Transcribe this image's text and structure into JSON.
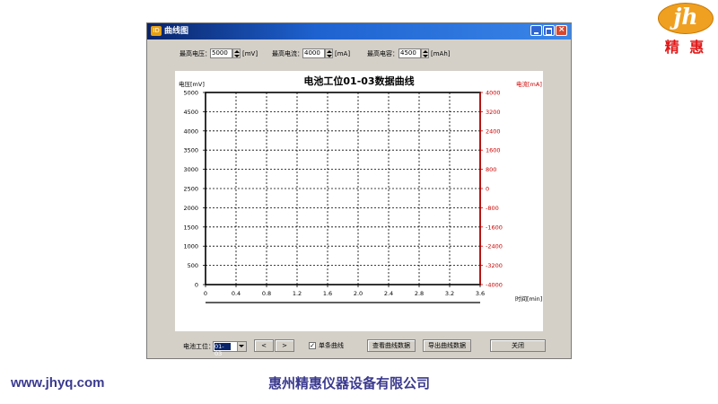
{
  "logo": {
    "mark": "jh",
    "text": "精 惠"
  },
  "footer": {
    "url": "www.jhyq.com",
    "company": "惠州精惠仪器设备有限公司"
  },
  "window": {
    "title": "曲线图",
    "app_icon": "app-icon"
  },
  "params": {
    "max_voltage_label": "最高电压：",
    "max_voltage_value": "5000",
    "max_voltage_unit": "[mV]",
    "max_current_label": "最高电流：",
    "max_current_value": "4000",
    "max_current_unit": "[mA]",
    "max_capacity_label": "最高电容：",
    "max_capacity_value": "4500",
    "max_capacity_unit": "[mAh]"
  },
  "chart_data": {
    "type": "line",
    "title": "电池工位01-03数据曲线",
    "ylabel": "电压[mV]",
    "y2label": "电流[mA]",
    "xlabel": "时间[min]",
    "ylim": [
      0,
      5000
    ],
    "y2lim": [
      -4000,
      4000
    ],
    "y_ticks": [
      "0",
      "500",
      "1000",
      "1500",
      "2000",
      "2500",
      "3000",
      "3500",
      "4000",
      "4500",
      "5000"
    ],
    "y2_ticks": [
      "-4000",
      "-3200",
      "-2400",
      "-1600",
      "-800",
      "0",
      "800",
      "1600",
      "2400",
      "3200",
      "4000"
    ],
    "x_ticks": [
      "0",
      "0.4",
      "0.8",
      "1.2",
      "1.6",
      "2.0",
      "2.4",
      "2.8",
      "3.2",
      "3.6"
    ],
    "grid": true,
    "series": []
  },
  "bottom": {
    "station_label": "电池工位：",
    "station_value": "01-03",
    "prev_label": "<",
    "next_label": ">",
    "single_curve_label": "单条曲线",
    "single_curve_checked": "✓",
    "view_data_label": "查看曲线数据",
    "export_data_label": "导出曲线数据",
    "close_label": "关闭"
  },
  "colors": {
    "left_axis": "#000000",
    "right_axis": "#cc0000",
    "title_bar": "#0a246a"
  }
}
